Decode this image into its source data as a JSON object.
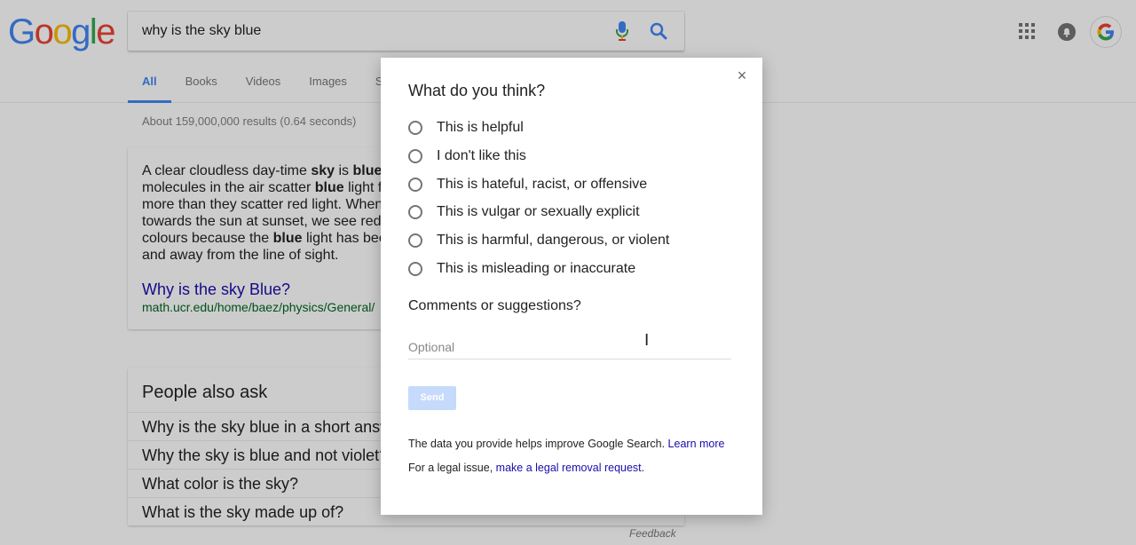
{
  "logo": {
    "letters": [
      "G",
      "o",
      "o",
      "g",
      "l",
      "e"
    ],
    "colors": [
      "#4285f4",
      "#ea4335",
      "#fbbc05",
      "#4285f4",
      "#34a853",
      "#ea4335"
    ]
  },
  "search": {
    "query": "why is the sky blue"
  },
  "icons": {
    "mic": "mic-icon",
    "search": "search-icon",
    "apps": "apps-grid-icon",
    "notifications": "bell-icon",
    "account": "google-g-icon"
  },
  "tabs": [
    {
      "label": "All"
    },
    {
      "label": "Books"
    },
    {
      "label": "Videos"
    },
    {
      "label": "Images"
    },
    {
      "label": "S"
    }
  ],
  "results_count": "About 159,000,000 results (0.64 seconds)",
  "snippet": {
    "lines": [
      "A clear cloudless day-time <b>sky</b> is <b>blue</b>",
      "molecules in the air scatter <b>blue</b> light f",
      "more than they scatter red light. When",
      "towards the sun at sunset, we see red",
      "colours because the <b>blue</b> light has bee",
      "and away from the line of sight."
    ],
    "link": "Why is the sky Blue?",
    "url": "math.ucr.edu/home/baez/physics/General/"
  },
  "people_also_ask": {
    "title": "People also ask",
    "items": [
      "Why is the sky blue in a short answ",
      "Why the sky is blue and not violet?",
      "What color is the sky?",
      "What is the sky made up of?"
    ]
  },
  "feedback_link": "Feedback",
  "dialog": {
    "close": "×",
    "title": "What do you think?",
    "options": [
      "This is helpful",
      "I don't like this",
      "This is hateful, racist, or offensive",
      "This is vulgar or sexually explicit",
      "This is harmful, dangerous, or violent",
      "This is misleading or inaccurate"
    ],
    "comments_label": "Comments or suggestions?",
    "comment_placeholder": "Optional",
    "send_label": "Send",
    "info_text": "The data you provide helps improve Google Search.",
    "info_link": "Learn more",
    "legal_text": "For a legal issue,",
    "legal_link": "make a legal removal request",
    "legal_suffix": "."
  },
  "colors": {
    "accent": "#4285f4",
    "link": "#1a0dab",
    "url": "#006621",
    "send_disabled": "#c6dafc"
  }
}
